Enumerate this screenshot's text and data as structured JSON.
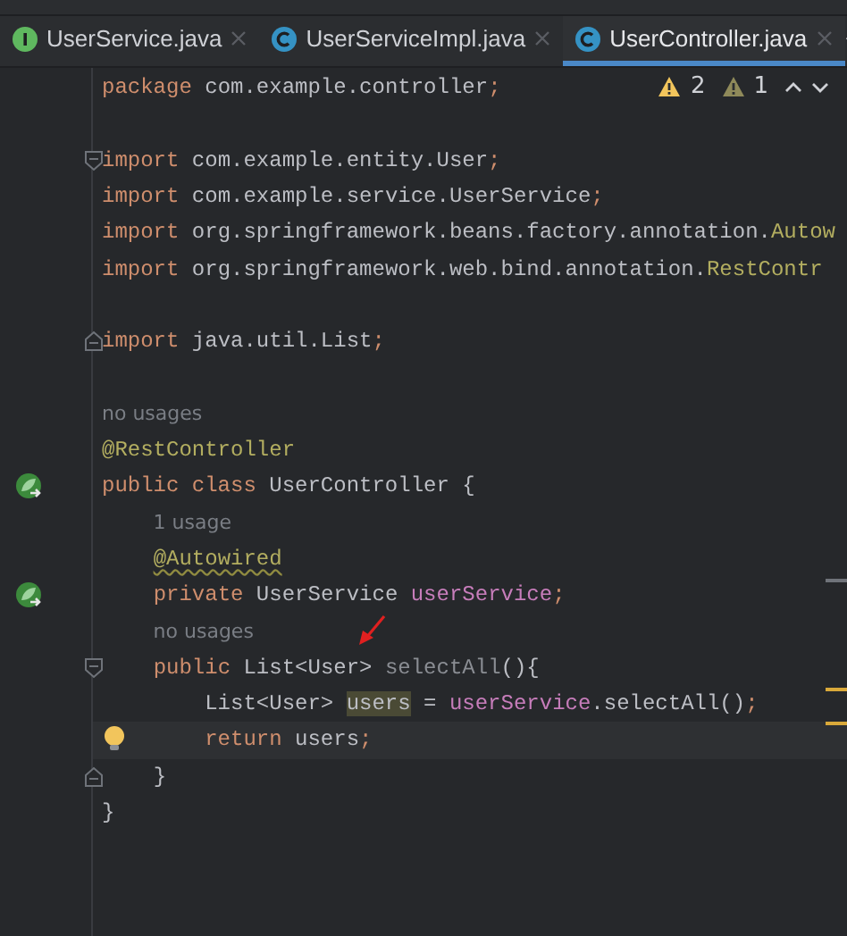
{
  "tabs": [
    {
      "label": "UserService.java",
      "kind": "interface",
      "selected": false
    },
    {
      "label": "UserServiceImpl.java",
      "kind": "class",
      "selected": false
    },
    {
      "label": "UserController.java",
      "kind": "class",
      "selected": true
    }
  ],
  "inspections": {
    "warnings": "2",
    "weak_warnings": "1"
  },
  "lines": [
    {
      "kind": "code",
      "tokens": [
        {
          "kind": "keyword",
          "text": "package"
        },
        {
          "kind": "plain",
          "text": " com.example.controller"
        },
        {
          "kind": "keyword",
          "text": ";"
        }
      ]
    },
    {
      "kind": "blank"
    },
    {
      "kind": "code",
      "fold_marker": {
        "kind": "start"
      },
      "tokens": [
        {
          "kind": "keyword",
          "text": "import"
        },
        {
          "kind": "plain",
          "text": " com.example.entity.User"
        },
        {
          "kind": "keyword",
          "text": ";"
        }
      ]
    },
    {
      "kind": "code",
      "tokens": [
        {
          "kind": "keyword",
          "text": "import"
        },
        {
          "kind": "plain",
          "text": " com.example.service.UserService"
        },
        {
          "kind": "keyword",
          "text": ";"
        }
      ]
    },
    {
      "kind": "code",
      "tokens": [
        {
          "kind": "keyword",
          "text": "import"
        },
        {
          "kind": "plain",
          "text": " org.springframework.beans.factory.annotation."
        },
        {
          "kind": "annotation",
          "text": "Autow"
        }
      ]
    },
    {
      "kind": "code",
      "tokens": [
        {
          "kind": "keyword",
          "text": "import"
        },
        {
          "kind": "plain",
          "text": " org.springframework.web.bind.annotation."
        },
        {
          "kind": "annotation",
          "text": "RestContr"
        }
      ]
    },
    {
      "kind": "blank"
    },
    {
      "kind": "code",
      "fold_marker": {
        "kind": "end"
      },
      "tokens": [
        {
          "kind": "keyword",
          "text": "import"
        },
        {
          "kind": "plain",
          "text": " java.util.List"
        },
        {
          "kind": "keyword",
          "text": ";"
        }
      ]
    },
    {
      "kind": "blank"
    },
    {
      "kind": "hint",
      "text": "no usages"
    },
    {
      "kind": "code",
      "tokens": [
        {
          "kind": "annotation",
          "text": "@RestController"
        }
      ]
    },
    {
      "kind": "code",
      "gutter": {
        "kind": "bean"
      },
      "tokens": [
        {
          "kind": "keyword",
          "text": "public class"
        },
        {
          "kind": "plain",
          "text": " UserController {"
        }
      ]
    },
    {
      "kind": "hint",
      "text": "1 usage"
    },
    {
      "kind": "code",
      "tokens": [
        {
          "kind": "annotation",
          "text": "    @Autowired",
          "warning": true
        }
      ]
    },
    {
      "kind": "code",
      "gutter": {
        "kind": "bean"
      },
      "tokens": [
        {
          "kind": "keyword",
          "text": "    private"
        },
        {
          "kind": "plain",
          "text": " UserService "
        },
        {
          "kind": "field",
          "text": "userService"
        },
        {
          "kind": "keyword",
          "text": ";"
        }
      ]
    },
    {
      "kind": "hint",
      "text": "no usages"
    },
    {
      "kind": "code",
      "fold_marker": {
        "kind": "start"
      },
      "tokens": [
        {
          "kind": "keyword",
          "text": "    public"
        },
        {
          "kind": "plain",
          "text": " List<User> "
        },
        {
          "kind": "unused",
          "text": "selectAll"
        },
        {
          "kind": "plain",
          "text": "(){"
        }
      ]
    },
    {
      "kind": "code",
      "tokens": [
        {
          "kind": "plain",
          "text": "        List<User> "
        },
        {
          "kind": "plain",
          "text": "users",
          "highlighted": true
        },
        {
          "kind": "plain",
          "text": " = "
        },
        {
          "kind": "field",
          "text": "userService"
        },
        {
          "kind": "plain",
          "text": ".selectAll()"
        },
        {
          "kind": "keyword",
          "text": ";"
        }
      ]
    },
    {
      "kind": "code",
      "gutter": {
        "kind": "bulb"
      },
      "current": true,
      "tokens": [
        {
          "kind": "keyword",
          "text": "        return"
        },
        {
          "kind": "plain",
          "text": " users"
        },
        {
          "kind": "keyword",
          "text": ";"
        }
      ]
    },
    {
      "kind": "code",
      "fold_marker": {
        "kind": "end"
      },
      "tokens": [
        {
          "kind": "plain",
          "text": "    }"
        }
      ]
    },
    {
      "kind": "code",
      "tokens": [
        {
          "kind": "plain",
          "text": "}"
        }
      ]
    }
  ]
}
